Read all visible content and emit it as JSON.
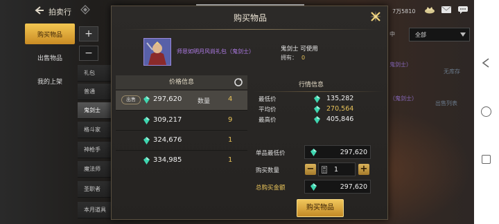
{
  "topbar": {
    "title": "拍卖行",
    "currency": "7万5810"
  },
  "sidebar": {
    "items": [
      {
        "label": "购买物品"
      },
      {
        "label": "出售物品"
      },
      {
        "label": "我的上架"
      }
    ]
  },
  "categories": {
    "add_symbol": "+",
    "minus_symbol": "−",
    "items": [
      "礼包",
      "普通",
      "鬼剑士",
      "格斗家",
      "神枪手",
      "魔法师",
      "圣职者",
      "本月道具"
    ]
  },
  "background": {
    "dropdown_label": "全部",
    "tab_label": "中",
    "row1_name": "鬼剑士）",
    "row1_status": "无库存",
    "row2_name": "（鬼剑士）",
    "row2_status": "出售列表"
  },
  "modal": {
    "title": "购买物品",
    "item_name": "师恩如明月风尚礼包（鬼剑士）",
    "item_class": "鬼剑士 可使用",
    "own_label": "拥有：",
    "own_value": "0",
    "price_header": "价格信息",
    "listings": [
      {
        "badge": "出售",
        "price": "297,620",
        "qty_label": "数量",
        "qty": "4"
      },
      {
        "price": "309,217",
        "qty": "9"
      },
      {
        "price": "324,676",
        "qty": "1"
      },
      {
        "price": "334,985",
        "qty": "1"
      }
    ],
    "market": {
      "title": "行情信息",
      "min_label": "最低价",
      "min_value": "135,282",
      "avg_label": "平均价",
      "avg_value": "270,564",
      "max_label": "最高价",
      "max_value": "405,846"
    },
    "purchase": {
      "unit_label": "单品最低价",
      "unit_value": "297,620",
      "qty_label": "购买数量",
      "qty_value": "1",
      "minus": "−",
      "plus": "+",
      "total_label": "总购买金额",
      "total_value": "297,620",
      "buy_button": "购买物品"
    }
  },
  "colors": {
    "gold": "#e8c35a",
    "item_name_purple": "#b07ce8",
    "gem_teal": "#3fd6b0",
    "button_gold": "#f0c65b"
  }
}
